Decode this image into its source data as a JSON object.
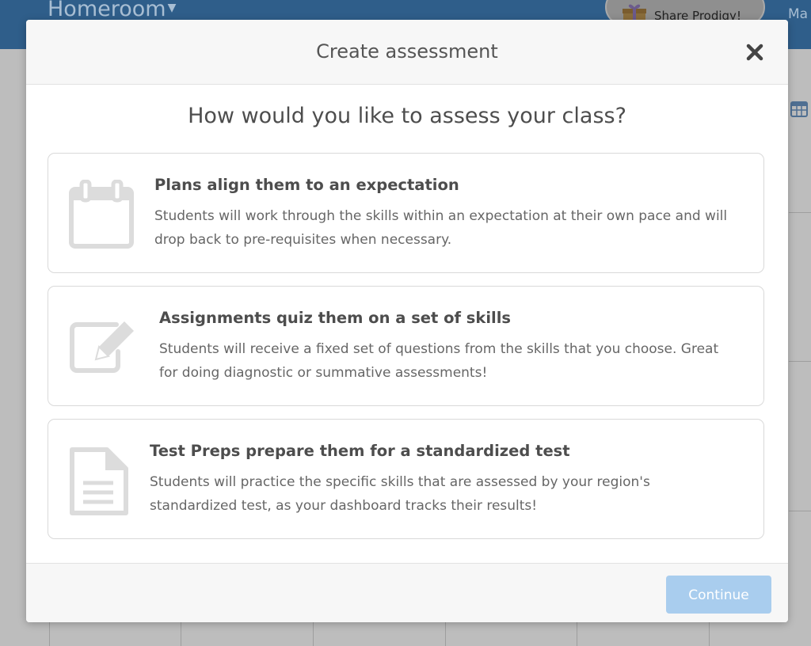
{
  "app": {
    "title": "Homeroom",
    "share_label": "Share Prodigy!",
    "user_label": "Ma",
    "colors": {
      "header": "#2f5e8a",
      "overlay": "#bdbdbd"
    }
  },
  "modal": {
    "title": "Create assessment",
    "close_icon": "close-icon",
    "question": "How would you like to assess your class?",
    "options": [
      {
        "icon": "calendar-icon",
        "title": "Plans align them to an expectation",
        "description_line1": "Students will work through the skills within an expectation at their own pace and will",
        "description_line2": "drop back to pre-requisites when necessary."
      },
      {
        "icon": "edit-icon",
        "title": "Assignments quiz them on a set of skills",
        "description_line1": "Students will receive a fixed set of questions from the skills that you choose. Great",
        "description_line2": "for doing diagnostic or summative assessments!"
      },
      {
        "icon": "document-icon",
        "title": "Test Preps prepare them for a standardized test",
        "description_line1": "Students will practice the specific skills that are assessed by your region's",
        "description_line2": "standardized test, as your dashboard tracks their results!"
      }
    ],
    "continue_label": "Continue",
    "colors": {
      "continue_button": "#a9cdee",
      "icon": "#dcdcdc"
    }
  }
}
